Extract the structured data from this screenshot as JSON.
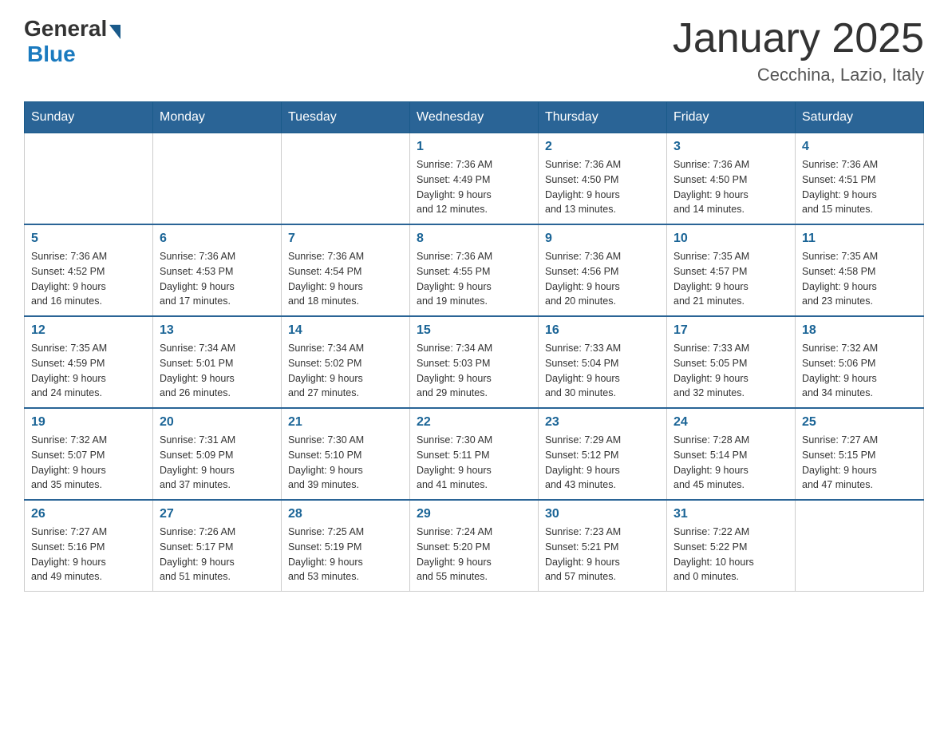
{
  "header": {
    "logo_general": "General",
    "logo_blue": "Blue",
    "month_title": "January 2025",
    "location": "Cecchina, Lazio, Italy"
  },
  "weekdays": [
    "Sunday",
    "Monday",
    "Tuesday",
    "Wednesday",
    "Thursday",
    "Friday",
    "Saturday"
  ],
  "weeks": [
    [
      {
        "day": "",
        "info": ""
      },
      {
        "day": "",
        "info": ""
      },
      {
        "day": "",
        "info": ""
      },
      {
        "day": "1",
        "info": "Sunrise: 7:36 AM\nSunset: 4:49 PM\nDaylight: 9 hours\nand 12 minutes."
      },
      {
        "day": "2",
        "info": "Sunrise: 7:36 AM\nSunset: 4:50 PM\nDaylight: 9 hours\nand 13 minutes."
      },
      {
        "day": "3",
        "info": "Sunrise: 7:36 AM\nSunset: 4:50 PM\nDaylight: 9 hours\nand 14 minutes."
      },
      {
        "day": "4",
        "info": "Sunrise: 7:36 AM\nSunset: 4:51 PM\nDaylight: 9 hours\nand 15 minutes."
      }
    ],
    [
      {
        "day": "5",
        "info": "Sunrise: 7:36 AM\nSunset: 4:52 PM\nDaylight: 9 hours\nand 16 minutes."
      },
      {
        "day": "6",
        "info": "Sunrise: 7:36 AM\nSunset: 4:53 PM\nDaylight: 9 hours\nand 17 minutes."
      },
      {
        "day": "7",
        "info": "Sunrise: 7:36 AM\nSunset: 4:54 PM\nDaylight: 9 hours\nand 18 minutes."
      },
      {
        "day": "8",
        "info": "Sunrise: 7:36 AM\nSunset: 4:55 PM\nDaylight: 9 hours\nand 19 minutes."
      },
      {
        "day": "9",
        "info": "Sunrise: 7:36 AM\nSunset: 4:56 PM\nDaylight: 9 hours\nand 20 minutes."
      },
      {
        "day": "10",
        "info": "Sunrise: 7:35 AM\nSunset: 4:57 PM\nDaylight: 9 hours\nand 21 minutes."
      },
      {
        "day": "11",
        "info": "Sunrise: 7:35 AM\nSunset: 4:58 PM\nDaylight: 9 hours\nand 23 minutes."
      }
    ],
    [
      {
        "day": "12",
        "info": "Sunrise: 7:35 AM\nSunset: 4:59 PM\nDaylight: 9 hours\nand 24 minutes."
      },
      {
        "day": "13",
        "info": "Sunrise: 7:34 AM\nSunset: 5:01 PM\nDaylight: 9 hours\nand 26 minutes."
      },
      {
        "day": "14",
        "info": "Sunrise: 7:34 AM\nSunset: 5:02 PM\nDaylight: 9 hours\nand 27 minutes."
      },
      {
        "day": "15",
        "info": "Sunrise: 7:34 AM\nSunset: 5:03 PM\nDaylight: 9 hours\nand 29 minutes."
      },
      {
        "day": "16",
        "info": "Sunrise: 7:33 AM\nSunset: 5:04 PM\nDaylight: 9 hours\nand 30 minutes."
      },
      {
        "day": "17",
        "info": "Sunrise: 7:33 AM\nSunset: 5:05 PM\nDaylight: 9 hours\nand 32 minutes."
      },
      {
        "day": "18",
        "info": "Sunrise: 7:32 AM\nSunset: 5:06 PM\nDaylight: 9 hours\nand 34 minutes."
      }
    ],
    [
      {
        "day": "19",
        "info": "Sunrise: 7:32 AM\nSunset: 5:07 PM\nDaylight: 9 hours\nand 35 minutes."
      },
      {
        "day": "20",
        "info": "Sunrise: 7:31 AM\nSunset: 5:09 PM\nDaylight: 9 hours\nand 37 minutes."
      },
      {
        "day": "21",
        "info": "Sunrise: 7:30 AM\nSunset: 5:10 PM\nDaylight: 9 hours\nand 39 minutes."
      },
      {
        "day": "22",
        "info": "Sunrise: 7:30 AM\nSunset: 5:11 PM\nDaylight: 9 hours\nand 41 minutes."
      },
      {
        "day": "23",
        "info": "Sunrise: 7:29 AM\nSunset: 5:12 PM\nDaylight: 9 hours\nand 43 minutes."
      },
      {
        "day": "24",
        "info": "Sunrise: 7:28 AM\nSunset: 5:14 PM\nDaylight: 9 hours\nand 45 minutes."
      },
      {
        "day": "25",
        "info": "Sunrise: 7:27 AM\nSunset: 5:15 PM\nDaylight: 9 hours\nand 47 minutes."
      }
    ],
    [
      {
        "day": "26",
        "info": "Sunrise: 7:27 AM\nSunset: 5:16 PM\nDaylight: 9 hours\nand 49 minutes."
      },
      {
        "day": "27",
        "info": "Sunrise: 7:26 AM\nSunset: 5:17 PM\nDaylight: 9 hours\nand 51 minutes."
      },
      {
        "day": "28",
        "info": "Sunrise: 7:25 AM\nSunset: 5:19 PM\nDaylight: 9 hours\nand 53 minutes."
      },
      {
        "day": "29",
        "info": "Sunrise: 7:24 AM\nSunset: 5:20 PM\nDaylight: 9 hours\nand 55 minutes."
      },
      {
        "day": "30",
        "info": "Sunrise: 7:23 AM\nSunset: 5:21 PM\nDaylight: 9 hours\nand 57 minutes."
      },
      {
        "day": "31",
        "info": "Sunrise: 7:22 AM\nSunset: 5:22 PM\nDaylight: 10 hours\nand 0 minutes."
      },
      {
        "day": "",
        "info": ""
      }
    ]
  ]
}
